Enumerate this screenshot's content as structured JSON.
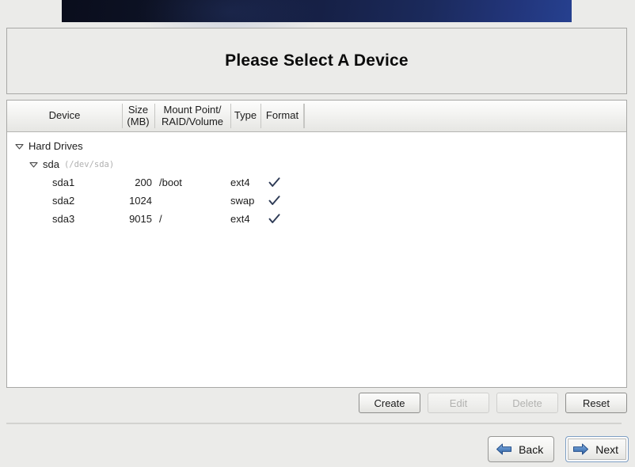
{
  "header": {
    "banner_color_left": "#0a0d1c",
    "banner_color_right": "#26408f"
  },
  "title": {
    "text": "Please Select A Device"
  },
  "table": {
    "columns": [
      {
        "label": "Device"
      },
      {
        "label": "Size\n(MB)",
        "line1": "Size",
        "line2": "(MB)"
      },
      {
        "label": "Mount Point/\nRAID/Volume",
        "line1": "Mount Point/",
        "line2": "RAID/Volume"
      },
      {
        "label": "Type"
      },
      {
        "label": "Format"
      }
    ],
    "rows": [
      {
        "device": "Hard Drives",
        "detail": "",
        "size": "",
        "mount": "",
        "type": "",
        "format": false,
        "indent": 0,
        "expander": "expanded"
      },
      {
        "device": "sda",
        "detail": "(/dev/sda)",
        "size": "",
        "mount": "",
        "type": "",
        "format": false,
        "indent": 1,
        "expander": "expanded"
      },
      {
        "device": "sda1",
        "detail": "",
        "size": "200",
        "mount": "/boot",
        "type": "ext4",
        "format": true,
        "indent": 2,
        "expander": "none"
      },
      {
        "device": "sda2",
        "detail": "",
        "size": "1024",
        "mount": "",
        "type": "swap",
        "format": true,
        "indent": 2,
        "expander": "none"
      },
      {
        "device": "sda3",
        "detail": "",
        "size": "9015",
        "mount": "/",
        "type": "ext4",
        "format": true,
        "indent": 2,
        "expander": "none"
      }
    ],
    "check_color": "#2d3a55"
  },
  "actions": [
    {
      "label": "Create",
      "enabled": true
    },
    {
      "label": "Edit",
      "enabled": false
    },
    {
      "label": "Delete",
      "enabled": false
    },
    {
      "label": "Reset",
      "enabled": true
    }
  ],
  "nav": {
    "back_label": "Back",
    "next_label": "Next",
    "arrow_color": "#3b6db5",
    "next_is_default": true
  }
}
